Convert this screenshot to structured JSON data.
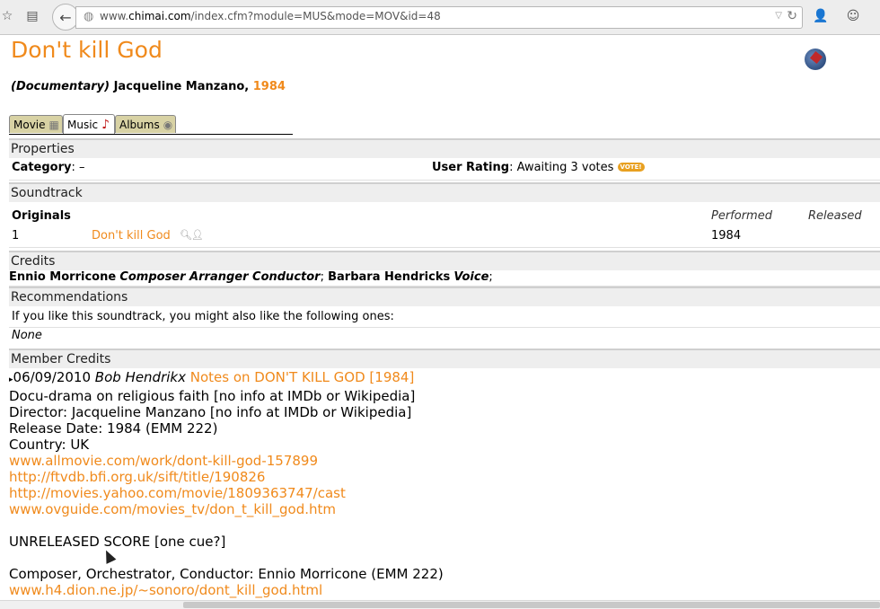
{
  "browser": {
    "url_prefix": "www.",
    "url_domain": "chimai.com",
    "url_path": "/index.cfm?module=MUS&mode=MOV&id=48"
  },
  "page": {
    "title": "Don't kill God",
    "type_label": "(Documentary)",
    "director": "Jacqueline Manzano,",
    "year": "1984"
  },
  "tabs": [
    {
      "label": "Movie",
      "icon": "film-icon"
    },
    {
      "label": "Music",
      "icon": "music-note-icon"
    },
    {
      "label": "Albums",
      "icon": "disc-icon"
    }
  ],
  "properties": {
    "header": "Properties",
    "category_label": "Category",
    "category_value": ": –",
    "rating_label": "User Rating",
    "rating_value": ": Awaiting 3 votes",
    "vote_badge": "VOTE!"
  },
  "soundtrack": {
    "header": "Soundtrack",
    "col_originals": "Originals",
    "col_performed": "Performed",
    "col_released": "Released",
    "rows": [
      {
        "num": "1",
        "title": "Don't kill God",
        "performed": "1984",
        "released": ""
      }
    ]
  },
  "credits": {
    "header": "Credits",
    "p1_name": "Ennio Morricone",
    "p1_roles": "Composer Arranger Conductor",
    "sep": ";",
    "p2_name": "Barbara Hendricks",
    "p2_roles": "Voice",
    "end": ";"
  },
  "recommendations": {
    "header": "Recommendations",
    "intro": "If you like this soundtrack, you might also like the following ones:",
    "none": "None"
  },
  "member_credits": {
    "header": "Member Credits",
    "date": "06/09/2010",
    "author": "Bob Hendrikx",
    "note_title": "Notes on DON'T KILL GOD [1984]",
    "lines": [
      {
        "text": "Docu-drama on religious faith [no info at IMDb or Wikipedia]",
        "link": false
      },
      {
        "text": "Director: Jacqueline Manzano [no info at IMDb or Wikipedia]",
        "link": false
      },
      {
        "text": "Release Date: 1984 (EMM 222)",
        "link": false
      },
      {
        "text": "Country: UK",
        "link": false
      },
      {
        "text": "www.allmovie.com/work/dont-kill-god-157899",
        "link": true
      },
      {
        "text": "http://ftvdb.bfi.org.uk/sift/title/190826",
        "link": true
      },
      {
        "text": "http://movies.yahoo.com/movie/1809363747/cast",
        "link": true
      },
      {
        "text": "www.ovguide.com/movies_tv/don_t_kill_god.htm",
        "link": true
      },
      {
        "text": "",
        "link": false
      },
      {
        "text": "UNRELEASED SCORE [one cue?]",
        "link": false
      },
      {
        "text": "",
        "link": false
      },
      {
        "text": "Composer, Orchestrator, Conductor: Ennio Morricone (EMM 222)",
        "link": false
      },
      {
        "text": "www.h4.dion.ne.jp/~sonoro/dont_kill_god.html",
        "link": true
      }
    ]
  }
}
